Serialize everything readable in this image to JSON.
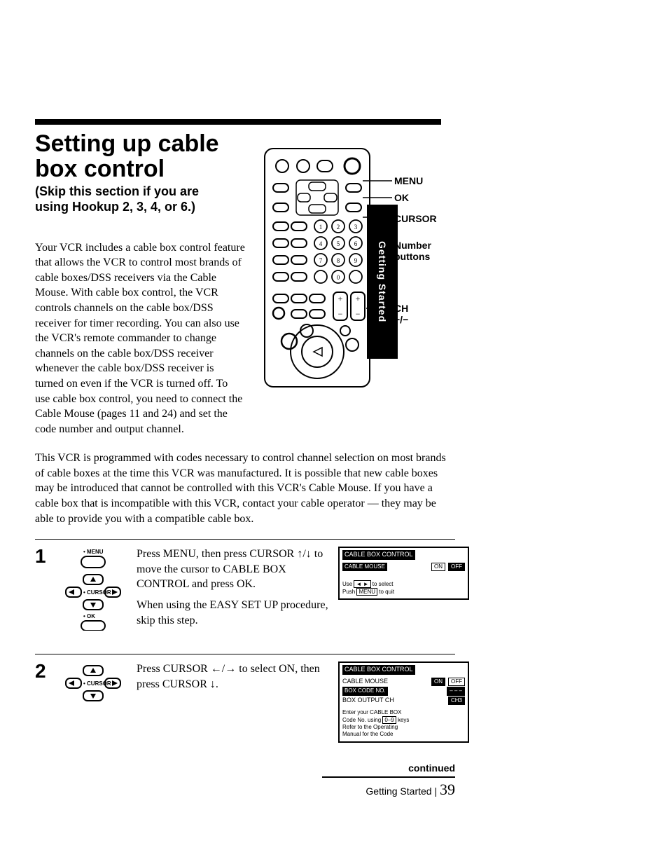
{
  "header": {
    "title_line1": "Setting up cable",
    "title_line2": "box control",
    "subtitle_line1": "(Skip this section if you are",
    "subtitle_line2": "using Hookup 2, 3, 4, or 6.)"
  },
  "intro": {
    "p1": "Your VCR includes a cable box control feature that allows the VCR to control most brands of cable boxes/DSS receivers via the Cable Mouse. With cable box control, the VCR controls channels on the cable box/DSS receiver for timer recording. You can also use the VCR's remote commander to change channels on the cable box/DSS receiver whenever the cable box/DSS receiver is turned on even if the VCR is turned off. To use cable box control, you need to connect the Cable Mouse (pages 11 and 24) and set the code number and output channel."
  },
  "body": {
    "p2": "This VCR is programmed with codes necessary to control channel selection on most brands of cable boxes at the time this VCR was manufactured. It is possible that new cable boxes may be introduced that cannot be controlled with this VCR's Cable Mouse. If you have a cable box that is incompatible with this VCR, contact your cable operator — they may be able to provide you with a compatible cable box."
  },
  "remote_labels": {
    "menu": "MENU",
    "ok": "OK",
    "cursor": "CURSOR",
    "number": "Number",
    "buttons": "buttons",
    "ch": "CH +/−"
  },
  "side_tab": "Getting Started",
  "steps": [
    {
      "num": "1",
      "icon_labels": {
        "menu": "• MENU",
        "cursor": "• CURSOR",
        "ok": "• OK"
      },
      "text1": "Press MENU, then press CURSOR ↑/↓ to move the cursor to CABLE BOX CONTROL and press OK.",
      "text2": "When using the EASY SET UP procedure, skip this step.",
      "osd": {
        "title": "CABLE BOX CONTROL",
        "row1_label": "CABLE MOUSE",
        "row1_on": "ON",
        "row1_off": "OFF",
        "hint1": "Use ◄ ► to select",
        "hint2": "Push MENU to quit"
      }
    },
    {
      "num": "2",
      "icon_labels": {
        "cursor": "• CURSOR"
      },
      "text1": "Press CURSOR ←/→ to select ON, then press CURSOR ↓.",
      "osd": {
        "title": "CABLE BOX CONTROL",
        "row1_label": "CABLE MOUSE",
        "row1_on": "ON",
        "row1_off": "OFF",
        "row2_label": "BOX CODE NO.",
        "row2_val": "– – –",
        "row3_label": "BOX OUTPUT CH",
        "row3_val": "CH3",
        "hint1": "Enter your CABLE BOX",
        "hint2": "Code No. using 0–9 keys",
        "hint3": "Refer to the Operating",
        "hint4": "Manual for the Code"
      }
    }
  ],
  "footer": {
    "continued": "continued",
    "section": "Getting Started",
    "page": "39"
  }
}
